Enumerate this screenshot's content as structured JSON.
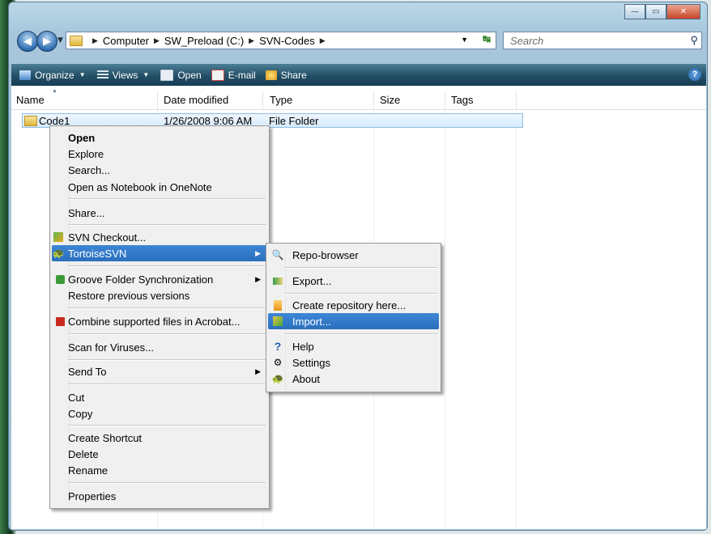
{
  "window": {
    "controls": {
      "minimize": "—",
      "maximize": "▭",
      "close": "✕"
    }
  },
  "address": {
    "crumbs": [
      "Computer",
      "SW_Preload (C:)",
      "SVN-Codes"
    ],
    "search_placeholder": "Search"
  },
  "toolbar": {
    "items": [
      "Organize",
      "Views",
      "Open",
      "E-mail",
      "Share"
    ]
  },
  "columns": [
    "Name",
    "Date modified",
    "Type",
    "Size",
    "Tags"
  ],
  "rows": [
    {
      "name": "Code1",
      "date": "1/26/2008 9:06 AM",
      "type": "File Folder"
    }
  ],
  "context_menu": {
    "open": "Open",
    "explore": "Explore",
    "search": "Search...",
    "onenote": "Open as Notebook in OneNote",
    "share": "Share...",
    "svn_checkout": "SVN Checkout...",
    "tortoisesvn": "TortoiseSVN",
    "groove": "Groove Folder Synchronization",
    "restore": "Restore previous versions",
    "acrobat": "Combine supported files in Acrobat...",
    "scan": "Scan for Viruses...",
    "send_to": "Send To",
    "cut": "Cut",
    "copy": "Copy",
    "create_shortcut": "Create Shortcut",
    "delete": "Delete",
    "rename": "Rename",
    "properties": "Properties"
  },
  "submenu": {
    "repo_browser": "Repo-browser",
    "export": "Export...",
    "create_repo": "Create repository here...",
    "import": "Import...",
    "help": "Help",
    "settings": "Settings",
    "about": "About"
  },
  "colors": {
    "highlight": "#3079c8",
    "toolbar": "#234f66"
  }
}
